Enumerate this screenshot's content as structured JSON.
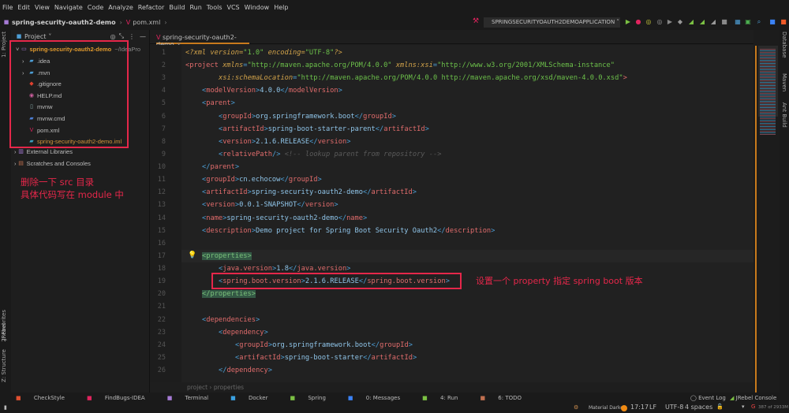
{
  "menu": [
    "File",
    "Edit",
    "View",
    "Navigate",
    "Code",
    "Analyze",
    "Refactor",
    "Build",
    "Run",
    "Tools",
    "VCS",
    "Window",
    "Help"
  ],
  "nav": {
    "project": "spring-security-oauth2-demo",
    "file": "pom.xml"
  },
  "run_config": "SPRINGSECURITYOAUTH2DEMOAPPLICATION",
  "left_strip": {
    "project": "1: Project",
    "favorites": "2: Favorites",
    "jrebel": "JRebel",
    "structure": "Z: Structure"
  },
  "right_strip": {
    "database": "Database",
    "maven": "Maven",
    "ant": "Ant Build"
  },
  "project_panel": {
    "title": "Project",
    "root": "spring-security-oauth2-demo",
    "root_path": "~/IdeaPro",
    "items": [
      {
        "name": ".idea",
        "icon": "folder"
      },
      {
        "name": ".mvn",
        "icon": "folder"
      },
      {
        "name": ".gitignore",
        "icon": "git"
      },
      {
        "name": "HELP.md",
        "icon": "markdown"
      },
      {
        "name": "mvnw",
        "icon": "file"
      },
      {
        "name": "mvnw.cmd",
        "icon": "cmd"
      },
      {
        "name": "pom.xml",
        "icon": "maven"
      },
      {
        "name": "spring-security-oauth2-demo.iml",
        "icon": "iml"
      }
    ],
    "external": "External Libraries",
    "scratches": "Scratches and Consoles"
  },
  "notes": {
    "note1_line1": "删除一下 src 目录",
    "note1_line2": "具体代码写在 module 中",
    "note2": "设置一个 property 指定 spring boot 版本"
  },
  "editor": {
    "tab": "spring-security-oauth2-demo",
    "lines": [
      [
        0,
        [
          [
            "decl",
            "<?xml version="
          ],
          [
            "str",
            "\"1.0\""
          ],
          [
            "decl",
            " encoding="
          ],
          [
            "str",
            "\"UTF-8\""
          ],
          [
            "decl",
            "?>"
          ]
        ]
      ],
      [
        0,
        [
          [
            "tag",
            "<project "
          ],
          [
            "attr",
            "xmlns"
          ],
          [
            "br",
            "="
          ],
          [
            "str",
            "\"http://maven.apache.org/POM/4.0.0\" "
          ],
          [
            "attr",
            "xmlns:xsi"
          ],
          [
            "br",
            "="
          ],
          [
            "str",
            "\"http://www.w3.org/2001/XMLSchema-instance\""
          ]
        ]
      ],
      [
        2,
        [
          [
            "attr",
            "xsi:schemaLocation"
          ],
          [
            "br",
            "="
          ],
          [
            "str",
            "\"http://maven.apache.org/POM/4.0.0 http://maven.apache.org/xsd/maven-4.0.0.xsd\""
          ],
          [
            "tag",
            ">"
          ]
        ]
      ],
      [
        1,
        [
          [
            "br",
            "<"
          ],
          [
            "tag",
            "modelVersion"
          ],
          [
            "br",
            ">"
          ],
          [
            "txt",
            "4.0.0"
          ],
          [
            "br",
            "</"
          ],
          [
            "tag",
            "modelVersion"
          ],
          [
            "br",
            ">"
          ]
        ]
      ],
      [
        1,
        [
          [
            "br",
            "<"
          ],
          [
            "tag",
            "parent"
          ],
          [
            "br",
            ">"
          ]
        ]
      ],
      [
        2,
        [
          [
            "br",
            "<"
          ],
          [
            "tag",
            "groupId"
          ],
          [
            "br",
            ">"
          ],
          [
            "txt",
            "org.springframework.boot"
          ],
          [
            "br",
            "</"
          ],
          [
            "tag",
            "groupId"
          ],
          [
            "br",
            ">"
          ]
        ]
      ],
      [
        2,
        [
          [
            "br",
            "<"
          ],
          [
            "tag",
            "artifactId"
          ],
          [
            "br",
            ">"
          ],
          [
            "txt",
            "spring-boot-starter-parent"
          ],
          [
            "br",
            "</"
          ],
          [
            "tag",
            "artifactId"
          ],
          [
            "br",
            ">"
          ]
        ]
      ],
      [
        2,
        [
          [
            "br",
            "<"
          ],
          [
            "tag",
            "version"
          ],
          [
            "br",
            ">"
          ],
          [
            "txt",
            "2.1.6.RELEASE"
          ],
          [
            "br",
            "</"
          ],
          [
            "tag",
            "version"
          ],
          [
            "br",
            ">"
          ]
        ]
      ],
      [
        2,
        [
          [
            "br",
            "<"
          ],
          [
            "tag",
            "relativePath"
          ],
          [
            "br",
            "/> "
          ],
          [
            "cm",
            "<!-- lookup parent from repository -->"
          ]
        ]
      ],
      [
        1,
        [
          [
            "br",
            "</"
          ],
          [
            "tag",
            "parent"
          ],
          [
            "br",
            ">"
          ]
        ]
      ],
      [
        1,
        [
          [
            "br",
            "<"
          ],
          [
            "tag",
            "groupId"
          ],
          [
            "br",
            ">"
          ],
          [
            "txt",
            "cn.echocow"
          ],
          [
            "br",
            "</"
          ],
          [
            "tag",
            "groupId"
          ],
          [
            "br",
            ">"
          ]
        ]
      ],
      [
        1,
        [
          [
            "br",
            "<"
          ],
          [
            "tag",
            "artifactId"
          ],
          [
            "br",
            ">"
          ],
          [
            "txt",
            "spring-security-oauth2-demo"
          ],
          [
            "br",
            "</"
          ],
          [
            "tag",
            "artifactId"
          ],
          [
            "br",
            ">"
          ]
        ]
      ],
      [
        1,
        [
          [
            "br",
            "<"
          ],
          [
            "tag",
            "version"
          ],
          [
            "br",
            ">"
          ],
          [
            "txt",
            "0.0.1-SNAPSHOT"
          ],
          [
            "br",
            "</"
          ],
          [
            "tag",
            "version"
          ],
          [
            "br",
            ">"
          ]
        ]
      ],
      [
        1,
        [
          [
            "br",
            "<"
          ],
          [
            "tag",
            "name"
          ],
          [
            "br",
            ">"
          ],
          [
            "txt",
            "spring-security-oauth2-demo"
          ],
          [
            "br",
            "</"
          ],
          [
            "tag",
            "name"
          ],
          [
            "br",
            ">"
          ]
        ]
      ],
      [
        1,
        [
          [
            "br",
            "<"
          ],
          [
            "tag",
            "description"
          ],
          [
            "br",
            ">"
          ],
          [
            "txt",
            "Demo project for Spring Boot Security Oauth2"
          ],
          [
            "br",
            "</"
          ],
          [
            "tag",
            "description"
          ],
          [
            "br",
            ">"
          ]
        ]
      ],
      [
        0,
        []
      ],
      [
        1,
        [
          [
            "hl",
            "<properties>"
          ]
        ]
      ],
      [
        2,
        [
          [
            "br",
            "<"
          ],
          [
            "tag",
            "java.version"
          ],
          [
            "br",
            ">"
          ],
          [
            "txt",
            "1.8"
          ],
          [
            "br",
            "</"
          ],
          [
            "tag",
            "java.version"
          ],
          [
            "br",
            ">"
          ]
        ]
      ],
      [
        2,
        [
          [
            "br",
            "<"
          ],
          [
            "tag",
            "spring.boot.version"
          ],
          [
            "br",
            ">"
          ],
          [
            "txt",
            "2.1.6.RELEASE"
          ],
          [
            "br",
            "</"
          ],
          [
            "tag",
            "spring.boot.version"
          ],
          [
            "br",
            ">"
          ]
        ]
      ],
      [
        1,
        [
          [
            "hl",
            "</properties>"
          ]
        ]
      ],
      [
        0,
        []
      ],
      [
        1,
        [
          [
            "br",
            "<"
          ],
          [
            "tag",
            "dependencies"
          ],
          [
            "br",
            ">"
          ]
        ]
      ],
      [
        2,
        [
          [
            "br",
            "<"
          ],
          [
            "tag",
            "dependency"
          ],
          [
            "br",
            ">"
          ]
        ]
      ],
      [
        3,
        [
          [
            "br",
            "<"
          ],
          [
            "tag",
            "groupId"
          ],
          [
            "br",
            ">"
          ],
          [
            "txt",
            "org.springframework.boot"
          ],
          [
            "br",
            "</"
          ],
          [
            "tag",
            "groupId"
          ],
          [
            "br",
            ">"
          ]
        ]
      ],
      [
        3,
        [
          [
            "br",
            "<"
          ],
          [
            "tag",
            "artifactId"
          ],
          [
            "br",
            ">"
          ],
          [
            "txt",
            "spring-boot-starter"
          ],
          [
            "br",
            "</"
          ],
          [
            "tag",
            "artifactId"
          ],
          [
            "br",
            ">"
          ]
        ]
      ],
      [
        2,
        [
          [
            "br",
            "</"
          ],
          [
            "tag",
            "dependency"
          ],
          [
            "br",
            ">"
          ]
        ]
      ]
    ]
  },
  "breadcrumb": [
    "project",
    "properties"
  ],
  "toolwindows": [
    "CheckStyle",
    "FindBugs-IDEA",
    "Terminal",
    "Docker",
    "Spring",
    "0: Messages",
    "4: Run",
    "6: TODO"
  ],
  "status": {
    "event_log": "Event Log",
    "jrebel_console": "JRebel Console",
    "theme": "Material Darker",
    "position": "17:17",
    "line_sep": "LF",
    "encoding": "UTF-8",
    "indent": "4 spaces",
    "memory": "387 of 2933M"
  }
}
